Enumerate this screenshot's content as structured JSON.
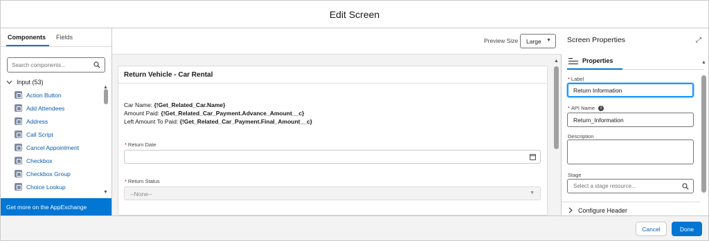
{
  "modal": {
    "title": "Edit Screen"
  },
  "left_panel": {
    "tabs": [
      {
        "label": "Components"
      },
      {
        "label": "Fields"
      }
    ],
    "search": {
      "placeholder": "Search components..."
    },
    "group": {
      "label": "Input (53)"
    },
    "items": [
      {
        "label": "Action Button"
      },
      {
        "label": "Add Attendees"
      },
      {
        "label": "Address"
      },
      {
        "label": "Call Script"
      },
      {
        "label": "Cancel Appointment"
      },
      {
        "label": "Checkbox"
      },
      {
        "label": "Checkbox Group"
      },
      {
        "label": "Choice Lookup"
      }
    ],
    "appexchange_label": "Get more on the AppExchange"
  },
  "center": {
    "preview_size": {
      "label": "Preview Size",
      "value": "Large"
    },
    "screen": {
      "title": "Return Vehicle - Car Rental",
      "lines": [
        {
          "prefix": "Car Name: ",
          "value": "{!Get_Related_Car.Name}"
        },
        {
          "prefix": "Amount Paid: ",
          "value": "{!Get_Related_Car_Payment.Advance_Amount__c}"
        },
        {
          "prefix": "Left Amount To Paid: ",
          "value": "{!Get_Related_Car_Payment.Final_Amount__c}"
        }
      ],
      "return_date": {
        "required_mark": "*",
        "label": "Return Date",
        "value": ""
      },
      "return_status": {
        "required_mark": "*",
        "label": "Return Status",
        "value": "--None--"
      }
    }
  },
  "right_panel": {
    "title": "Screen Properties",
    "tab_label": "Properties",
    "label_field": {
      "required_mark": "*",
      "label": "Label",
      "value": "Return Information"
    },
    "api_name_field": {
      "required_mark": "*",
      "label": "API Name",
      "value": "Return_Information"
    },
    "description_field": {
      "label": "Description",
      "value": ""
    },
    "stage_field": {
      "label": "Stage",
      "placeholder": "Select a stage resource..."
    },
    "configure_header": "Configure Header"
  },
  "footer": {
    "cancel_label": "Cancel",
    "done_label": "Done"
  },
  "colors": {
    "brand": "#0176d3",
    "link": "#0b5cab",
    "focus": "#1b96ff",
    "required": "#ba0517"
  }
}
